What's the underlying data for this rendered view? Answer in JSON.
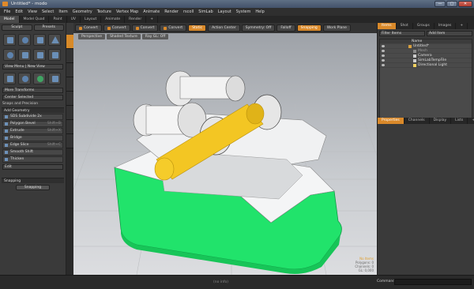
{
  "window": {
    "title": "Untitled* - modo",
    "buttons": [
      "—",
      "▢",
      "✕"
    ]
  },
  "menu": [
    "File",
    "Edit",
    "View",
    "Select",
    "Item",
    "Geometry",
    "Texture",
    "Vertex Map",
    "Animate",
    "Render",
    "rscoll",
    "SimLab",
    "Layout",
    "System",
    "Help"
  ],
  "tabs": [
    "Model",
    "Model Quad",
    "Paint",
    "UV",
    "Layout",
    "Animate",
    "Render",
    "+"
  ],
  "left": {
    "top_buttons": [
      "Sculpt",
      "Presets"
    ],
    "view_menu": "View Menu | New View",
    "more_transforms": "More Transforms",
    "center": "Center Selected",
    "snaps_label": "Snaps and Precision",
    "add_geometry": "Add Geometry",
    "tools": [
      {
        "label": "SDS Subdivide 2x",
        "shortcut": ""
      },
      {
        "label": "Polygon Bevel",
        "shortcut": "Shift+B"
      },
      {
        "label": "Extrude",
        "shortcut": "Shift+X"
      },
      {
        "label": "Bridge",
        "shortcut": ""
      },
      {
        "label": "Edge Slice",
        "shortcut": "Shift+C"
      },
      {
        "label": "Smooth Shift",
        "shortcut": ""
      },
      {
        "label": "Thicken",
        "shortcut": ""
      }
    ],
    "edit": "Edit",
    "snapping_section": "Snapping",
    "snapping_button": "Snapping"
  },
  "toolbar": {
    "items": [
      "Convert",
      "Convert",
      "Convert",
      "Convert",
      "Static",
      "Action Center",
      "Symmetry: Off",
      "Falloff",
      "Snapping",
      "Work Plane"
    ]
  },
  "viewport": {
    "header": [
      "Perspective",
      "Shaded Texture",
      "Ray GL: Off"
    ],
    "info": [
      "No Items",
      "Polygons: 0",
      "Channels: 0",
      "GL: 0,000"
    ]
  },
  "right": {
    "tabs": [
      "Items",
      "Shot",
      "Groups",
      "Images",
      "+"
    ],
    "filter": "Filter Items",
    "add_item": "Add Item",
    "list_header": "Name",
    "items": [
      {
        "label": "Untitled*",
        "indent": 1
      },
      {
        "label": "Mesh",
        "indent": 2
      },
      {
        "label": "Camera",
        "indent": 2
      },
      {
        "label": "SimLabTempFile",
        "indent": 2
      },
      {
        "label": "Directional Light",
        "indent": 2
      }
    ],
    "tabs2": [
      "Properties",
      "Channels",
      "Display",
      "Lists",
      "+"
    ]
  },
  "status": {
    "middle": "(no info)",
    "command_label": "Command"
  },
  "colors": {
    "accent": "#d9892a",
    "green": "#22e06a",
    "gear": "#f0c020"
  }
}
